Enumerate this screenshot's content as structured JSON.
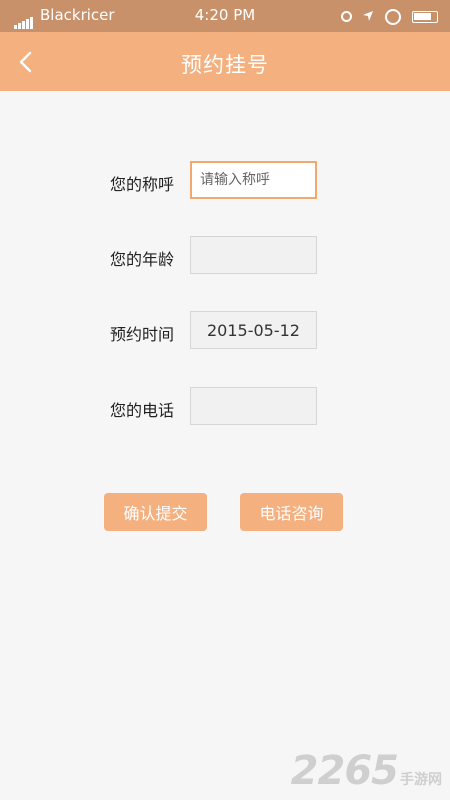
{
  "status_bar": {
    "carrier": "Blackricer",
    "time": "4:20 PM"
  },
  "nav": {
    "title": "预约挂号",
    "back_icon": "chevron-left-icon"
  },
  "form": {
    "name": {
      "label": "您的称呼",
      "value": "",
      "placeholder": "请输入称呼"
    },
    "age": {
      "label": "您的年龄",
      "value": "",
      "placeholder": ""
    },
    "date": {
      "label": "预约时间",
      "value": "2015-05-12"
    },
    "phone": {
      "label": "您的电话",
      "value": "",
      "placeholder": ""
    }
  },
  "actions": {
    "submit_label": "确认提交",
    "consult_label": "电话咨询"
  },
  "watermark": {
    "number": "2265",
    "text": "手游网"
  },
  "colors": {
    "accent": "#f4b07f",
    "status_bar": "#c9916a",
    "background": "#f6f6f6"
  }
}
